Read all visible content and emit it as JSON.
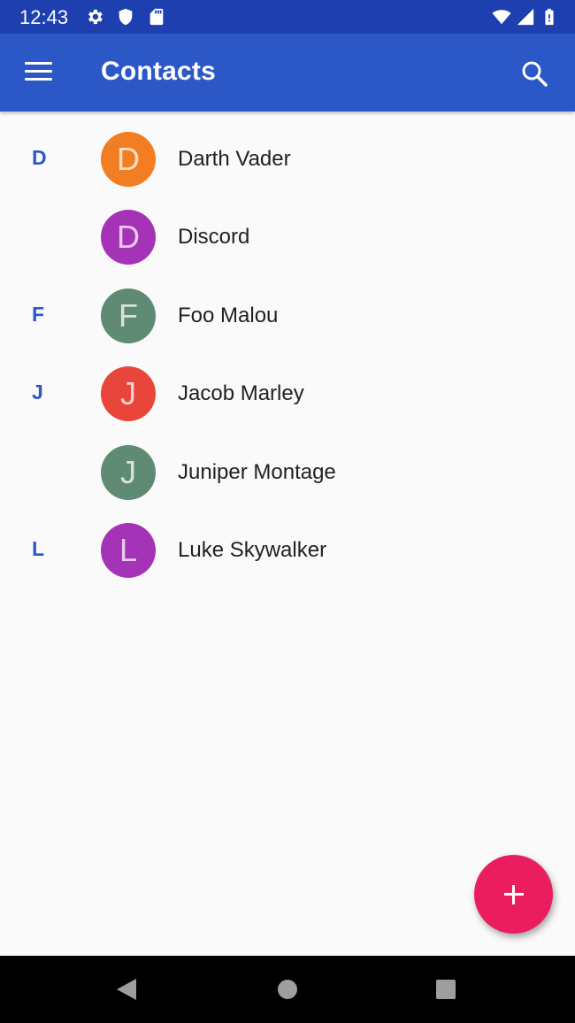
{
  "status_bar": {
    "time": "12:43",
    "icons": [
      "settings-gear-icon",
      "shield-icon",
      "sd-card-icon",
      "wifi-icon",
      "signal-icon",
      "battery-icon"
    ]
  },
  "app_bar": {
    "title": "Contacts",
    "color": "#2b57c7",
    "icons": [
      "menu-icon",
      "search-icon"
    ]
  },
  "contacts": [
    {
      "section": "D",
      "initial": "D",
      "name": "Darth Vader",
      "color": "#f27d22"
    },
    {
      "section": "",
      "initial": "D",
      "name": "Discord",
      "color": "#a433b7"
    },
    {
      "section": "F",
      "initial": "F",
      "name": "Foo Malou",
      "color": "#5f8a73"
    },
    {
      "section": "J",
      "initial": "J",
      "name": "Jacob Marley",
      "color": "#e8463a"
    },
    {
      "section": "",
      "initial": "J",
      "name": "Juniper Montage",
      "color": "#5f8a73"
    },
    {
      "section": "L",
      "initial": "L",
      "name": "Luke Skywalker",
      "color": "#a433b7"
    }
  ],
  "fab": {
    "icon": "add-icon",
    "color": "#ea1e5f"
  },
  "nav_bar": {
    "icons": [
      "back-icon",
      "home-icon",
      "recents-icon"
    ]
  }
}
